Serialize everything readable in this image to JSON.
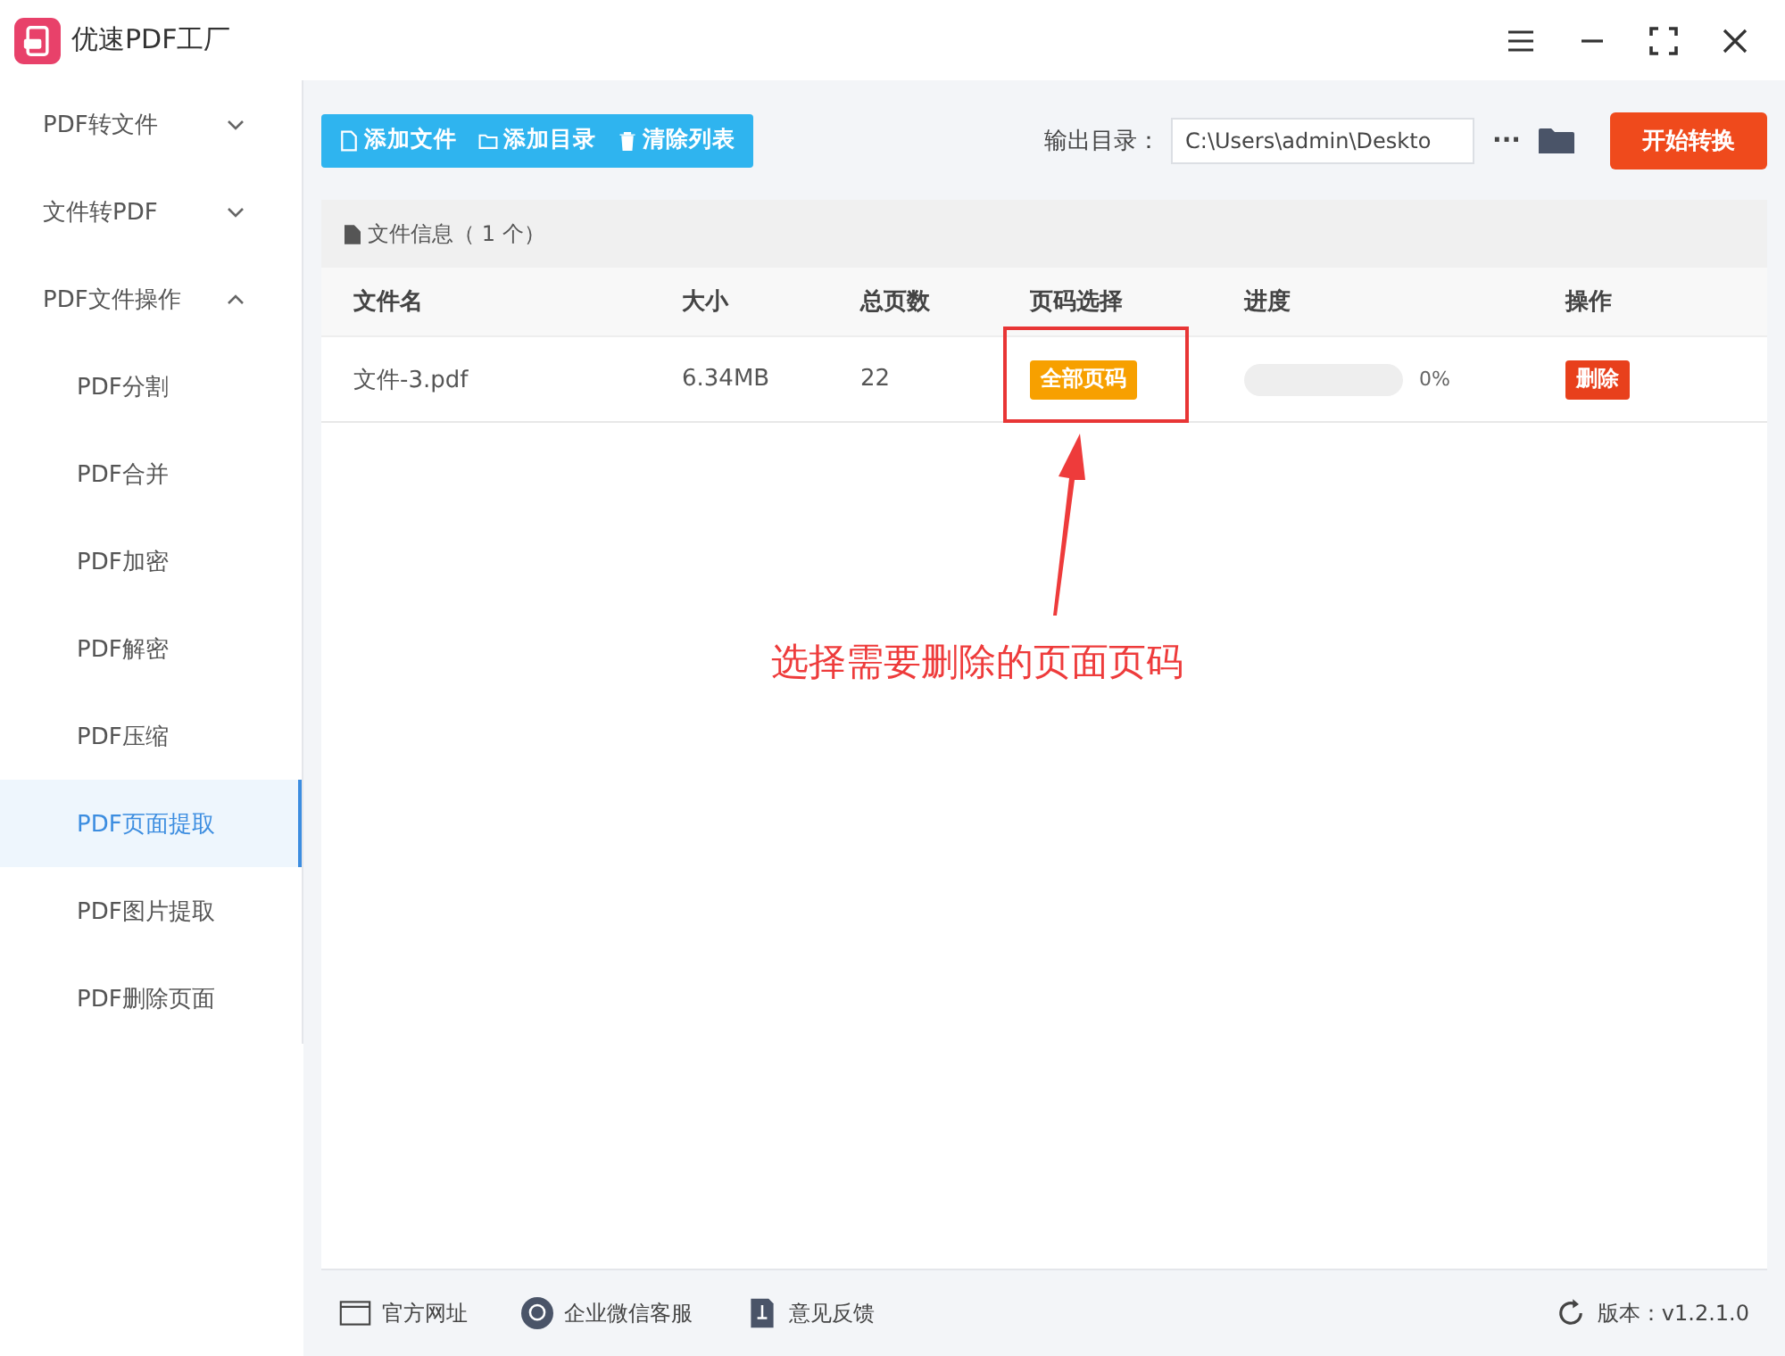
{
  "app": {
    "title": "优速PDF工厂"
  },
  "sidebar": {
    "groups": [
      {
        "label": "PDF转文件",
        "expanded": false
      },
      {
        "label": "文件转PDF",
        "expanded": false
      },
      {
        "label": "PDF文件操作",
        "expanded": true,
        "children": [
          {
            "label": "PDF分割",
            "selected": false
          },
          {
            "label": "PDF合并",
            "selected": false
          },
          {
            "label": "PDF加密",
            "selected": false
          },
          {
            "label": "PDF解密",
            "selected": false
          },
          {
            "label": "PDF压缩",
            "selected": false
          },
          {
            "label": "PDF页面提取",
            "selected": true
          },
          {
            "label": "PDF图片提取",
            "selected": false
          },
          {
            "label": "PDF删除页面",
            "selected": false
          }
        ]
      }
    ]
  },
  "toolbar": {
    "buttons": [
      {
        "kind": "file",
        "label": "添加文件"
      },
      {
        "kind": "folder",
        "label": "添加目录"
      },
      {
        "kind": "trash",
        "label": "清除列表"
      }
    ],
    "output_label": "输出目录：",
    "output_path": "C:\\Users\\admin\\Deskto",
    "more": "···",
    "start": "开始转换"
  },
  "table": {
    "title": "文件信息（ 1 个）",
    "columns": [
      "文件名",
      "大小",
      "总页数",
      "页码选择",
      "进度",
      "操作"
    ],
    "rows": [
      {
        "name": "文件-3.pdf",
        "size": "6.34MB",
        "pages": "22",
        "page_select": "全部页码",
        "level": 0,
        "reading": "0%",
        "action": "删除"
      }
    ]
  },
  "annotation": {
    "text": "选择需要删除的页面页码"
  },
  "footer": {
    "links": [
      {
        "kind": "web",
        "label": "官方网址"
      },
      {
        "kind": "chat",
        "label": "企业微信客服"
      },
      {
        "kind": "feedback",
        "label": "意见反馈"
      }
    ],
    "version": "版本：v1.2.1.0"
  }
}
